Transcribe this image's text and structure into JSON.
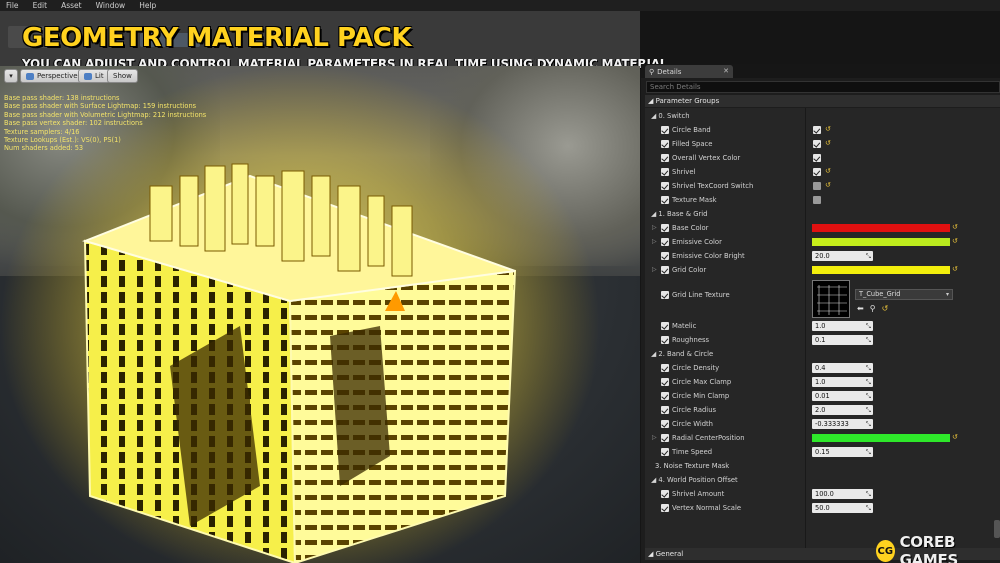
{
  "menu": [
    "File",
    "Edit",
    "Asset",
    "Window",
    "Help"
  ],
  "banner": {
    "title": "GEOMETRY MATERIAL PACK",
    "subtitle": "YOU CAN ADJUST AND CONTROL MATERIAL PARAMETERS IN REAL TIME USING DYNAMIC MATERIAL"
  },
  "viewport": {
    "buttons": {
      "menu": "▾",
      "perspective": "Perspective",
      "lit": "Lit",
      "show": "Show"
    },
    "stats": [
      "Base pass shader: 138 instructions",
      "Base pass shader with Surface Lightmap: 159 instructions",
      "Base pass shader with Volumetric Lightmap: 212 instructions",
      "Base pass vertex shader: 102 instructions",
      "Texture samplers: 4/16",
      "Texture Lookups (Est.): VS(0), PS(1)",
      "Num shaders added: 53"
    ]
  },
  "details": {
    "tab": "Details",
    "search_placeholder": "Search Details",
    "parameter_groups": "Parameter Groups",
    "general": "General",
    "texture_name": "T_Cube_Grid",
    "sections": {
      "switch": "0. Switch",
      "base_grid": "1. Base & Grid",
      "band_circle": "2. Band & Circle",
      "noise": "3. Noise Texture Mask",
      "wpo": "4. World Position Offset"
    },
    "switch_params": [
      {
        "label": "Circle Band",
        "on": true
      },
      {
        "label": "Filled Space",
        "on": true
      },
      {
        "label": "Overall Vertex Color",
        "on": true
      },
      {
        "label": "Shrivel",
        "on": true
      },
      {
        "label": "Shrivel TexCoord Switch",
        "on": false
      },
      {
        "label": "Texture Mask",
        "on": false
      }
    ],
    "base_params": {
      "base_color": "Base Color",
      "emissive_color": "Emissive Color",
      "emissive_bright": "Emissive Color Bright",
      "emissive_bright_value": "20.0",
      "grid_color": "Grid Color",
      "grid_texture": "Grid Line Texture",
      "metallic": "Matelic",
      "metallic_value": "1.0",
      "roughness": "Roughness",
      "roughness_value": "0.1"
    },
    "band_params": [
      {
        "label": "Circle Density",
        "value": "0.4"
      },
      {
        "label": "Circle Max Clamp",
        "value": "1.0"
      },
      {
        "label": "Circle Min Clamp",
        "value": "0.01"
      },
      {
        "label": "Circle Radius",
        "value": "2.0"
      },
      {
        "label": "Circle Width",
        "value": "-0.333333"
      }
    ],
    "radial_center": "Radial CenterPosition",
    "time_speed": "Time Speed",
    "time_speed_value": "0.15",
    "wpo_params": [
      {
        "label": "Shrivel Amount",
        "value": "100.0"
      },
      {
        "label": "Vertex Normal Scale",
        "value": "50.0"
      }
    ]
  },
  "colors": {
    "base_color": "#e01010",
    "emissive_color": "#c8ef1a",
    "grid_color": "#f2ee0c",
    "radial_center": "#2ee82a",
    "accent": "#ffd21f"
  },
  "logo": {
    "badge": "CG",
    "text": "COREB GAMES"
  }
}
